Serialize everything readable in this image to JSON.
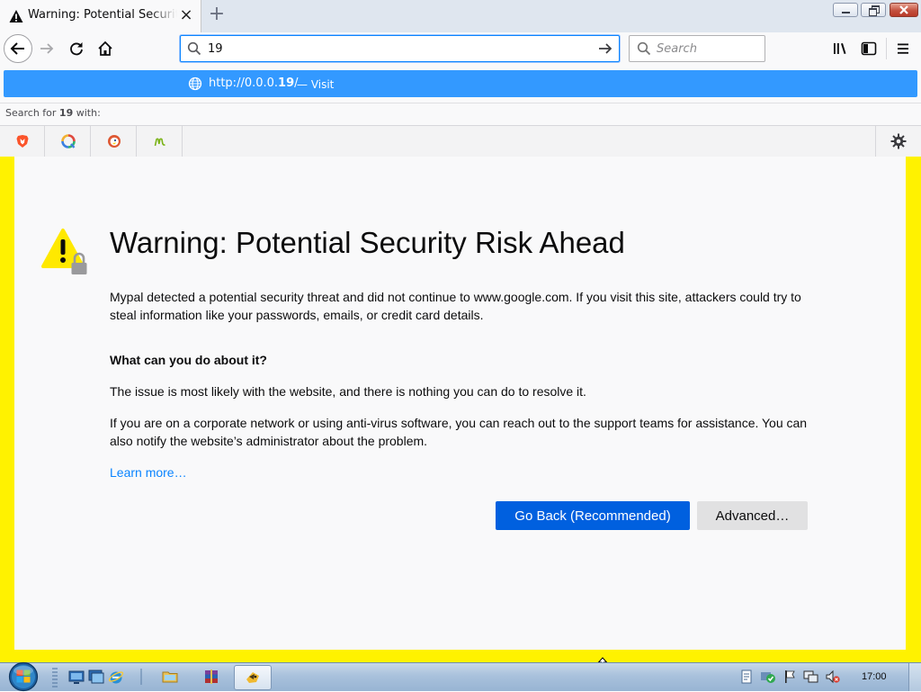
{
  "browser": {
    "tab": {
      "title": "Warning: Potential Security Risk Ahead",
      "icon": "warning-icon"
    },
    "url_input_value": "19",
    "search_placeholder": "Search"
  },
  "autocomplete": {
    "suggestion_url_prefix": "http://0.0.0.",
    "suggestion_url_bold": "19",
    "suggestion_url_suffix": "/",
    "suggestion_action": "— Visit",
    "search_for_prefix": "Search for ",
    "search_for_term": "19",
    "search_for_suffix": " with:",
    "engines": [
      "brave-icon",
      "qwant-icon",
      "duckduckgo-icon",
      "mojeek-icon"
    ]
  },
  "page": {
    "title": "Warning: Potential Security Risk Ahead",
    "threat_text": "Mypal detected a potential security threat and did not continue to www.google.com. If you visit this site, attackers could try to steal information like your passwords, emails, or credit card details.",
    "what_heading": "What can you do about it?",
    "issue_text": "The issue is most likely with the website, and there is nothing you can do to resolve it.",
    "corporate_text": "If you are on a corporate network or using anti-virus software, you can reach out to the support teams for assistance. You can also notify the website’s administrator about the problem.",
    "learn_more": "Learn more…",
    "go_back_label": "Go Back (Recommended)",
    "advanced_label": "Advanced…"
  },
  "taskbar": {
    "clock": "17:00"
  },
  "colors": {
    "page_border": "#fff200",
    "suggestion_highlight": "#3399ff",
    "primary_button": "#0060df",
    "link": "#0a84ff"
  }
}
